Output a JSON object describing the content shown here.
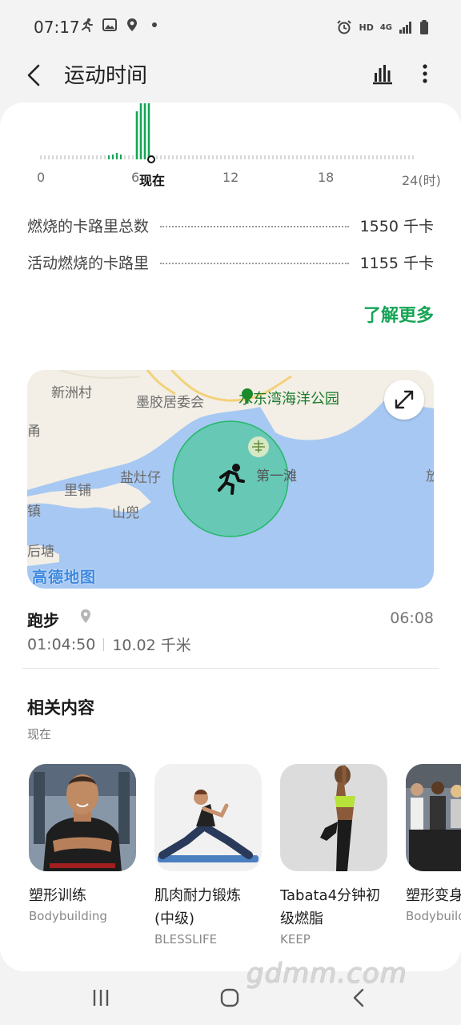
{
  "status_bar": {
    "time": "07:17",
    "hd": "HD",
    "net": "4G"
  },
  "app_bar": {
    "title": "运动时间"
  },
  "hourly_chart": {
    "axis_labels": [
      "0",
      "6",
      "现在",
      "12",
      "18",
      "24(时)"
    ],
    "accent": "#16a456"
  },
  "stats": [
    {
      "label": "燃烧的卡路里总数",
      "value": "1550 千卡"
    },
    {
      "label": "活动燃烧的卡路里",
      "value": "1155 千卡"
    }
  ],
  "learn_more": "了解更多",
  "map": {
    "labels": [
      "新洲村",
      "墨胶居委会",
      "甬",
      "盐灶仔",
      "里铺",
      "镇",
      "山兜",
      "后塘",
      "第一滩",
      "放"
    ],
    "poi": "水东湾海洋公园",
    "logo": "高德地图"
  },
  "exercise": {
    "name": "跑步",
    "time": "06:08",
    "duration": "01:04:50",
    "distance": "10.02 千米"
  },
  "related": {
    "title": "相关内容",
    "subtitle": "现在",
    "items": [
      {
        "name": "塑形训练",
        "source": "Bodybuilding"
      },
      {
        "name": "肌肉耐力锻炼\n(中级)",
        "source": "BLESSLIFE"
      },
      {
        "name": "Tabata4分钟初\n级燃脂",
        "source": "KEEP"
      },
      {
        "name": "塑形变身",
        "source": "Bodybuilding"
      }
    ]
  },
  "watermark": "gdmm.com"
}
